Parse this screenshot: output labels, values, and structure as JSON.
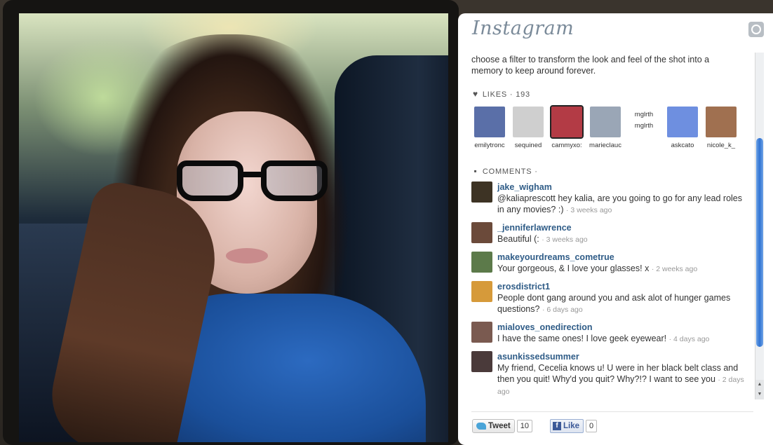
{
  "app": {
    "logo_text": "Instagram"
  },
  "post": {
    "caption": "choose a filter to transform the look and feel of the shot into a memory to keep around forever.",
    "likes_label": "LIKES · 193",
    "comments_label": "COMMENTS ·"
  },
  "likes": [
    {
      "name": "emilytronc",
      "color": "#5a6fa8"
    },
    {
      "name": "sequined",
      "color": "#cfcfcf"
    },
    {
      "name": "cammyxo:",
      "color": "#b33b45"
    },
    {
      "name": "marieclauc",
      "color": "#9aa6b6"
    },
    {
      "name": "mglrth\nmglrth",
      "color": "#ffffff"
    },
    {
      "name": "askcato",
      "color": "#6e8fe0"
    },
    {
      "name": "nicole_k_",
      "color": "#a07050"
    }
  ],
  "comments": [
    {
      "user": "jake_wigham",
      "text": "@kaliaprescott hey kalia, are you going to go for any lead roles in any movies? :)",
      "time": "· 3 weeks ago",
      "color": "#3d3324"
    },
    {
      "user": "_jenniferlawrence",
      "text": "Beautiful (:",
      "time": "· 3 weeks ago",
      "color": "#6b4a3a"
    },
    {
      "user": "makeyourdreams_cometrue",
      "text": "Your gorgeous, & I love your glasses! x",
      "time": "· 2 weeks ago",
      "color": "#5c7a4a"
    },
    {
      "user": "erosdistrict1",
      "text": "People dont gang around you and ask alot of hunger games questions?",
      "time": "· 6 days ago",
      "color": "#d69a3a"
    },
    {
      "user": "mialoves_onedirection",
      "text": "I have the same ones! I love geek eyewear!",
      "time": "· 4 days ago",
      "color": "#7a5a50"
    },
    {
      "user": "asunkissedsummer",
      "text": "My friend, Cecelia knows u! U were in her black belt class and then you quit! Why'd you quit? Why?!? I want to see you",
      "time": "· 2 days ago",
      "color": "#4a3a3a"
    }
  ],
  "share": {
    "tweet_label": "Tweet",
    "tweet_count": "10",
    "like_label": "Like",
    "like_count": "0"
  }
}
